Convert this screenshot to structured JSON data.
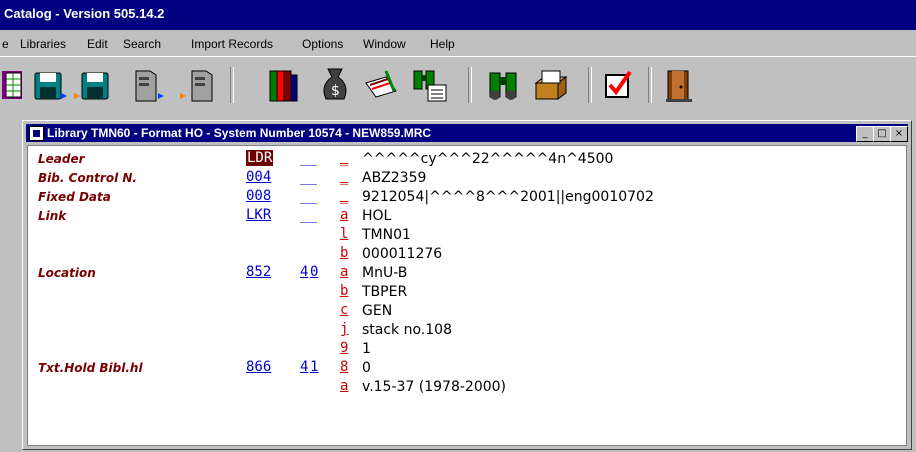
{
  "app": {
    "title": "Catalog - Version 505.14.2"
  },
  "menu": {
    "items": [
      {
        "label": "Libraries"
      },
      {
        "label": "Edit"
      },
      {
        "label": "Search"
      },
      {
        "label": "Import Records"
      },
      {
        "label": "Options"
      },
      {
        "label": "Window"
      },
      {
        "label": "Help"
      }
    ]
  },
  "toolbar": {
    "icons": [
      "grid-icon",
      "save-icon",
      "save-to-icon",
      "server-icon",
      "server-to-icon",
      "books-icon",
      "money-bag-icon",
      "edit-record-icon",
      "binoculars-list-icon",
      "binoculars-icon",
      "card-file-icon",
      "checkbox-icon",
      "exit-door-icon"
    ]
  },
  "record_window": {
    "title": "Library TMN60 - Format HO - System Number 10574 - NEW859.MRC",
    "minimize": "_",
    "maximize": "□",
    "close": "×"
  },
  "record": {
    "rows": [
      {
        "label": "Leader",
        "tag": "LDR",
        "ind1": "",
        "ind2": "",
        "sub": "",
        "value": "^^^^^cy^^^22^^^^^4n^4500"
      },
      {
        "label": "Bib. Control N.",
        "tag": "004",
        "ind1": "",
        "ind2": "",
        "sub": "",
        "value": "ABZ2359"
      },
      {
        "label": "Fixed Data",
        "tag": "008",
        "ind1": "",
        "ind2": "",
        "sub": "",
        "value": "9212054|^^^^8^^^2001||eng0010702"
      },
      {
        "label": "Link",
        "tag": "LKR",
        "ind1": "",
        "ind2": "",
        "sub": "a",
        "value": "HOL"
      },
      {
        "label": "",
        "tag": "",
        "ind1": "",
        "ind2": "",
        "sub": "l",
        "value": "TMN01"
      },
      {
        "label": "",
        "tag": "",
        "ind1": "",
        "ind2": "",
        "sub": "b",
        "value": "000011276"
      },
      {
        "label": "Location",
        "tag": "852",
        "ind1": "4",
        "ind2": "0",
        "sub": "a",
        "value": "MnU-B"
      },
      {
        "label": "",
        "tag": "",
        "ind1": "",
        "ind2": "",
        "sub": "b",
        "value": "TBPER"
      },
      {
        "label": "",
        "tag": "",
        "ind1": "",
        "ind2": "",
        "sub": "c",
        "value": "GEN"
      },
      {
        "label": "",
        "tag": "",
        "ind1": "",
        "ind2": "",
        "sub": "j",
        "value": "stack no.108"
      },
      {
        "label": "",
        "tag": "",
        "ind1": "",
        "ind2": "",
        "sub": "9",
        "value": "1"
      },
      {
        "label": "Txt.Hold Bibl.hl",
        "tag": "866",
        "ind1": "4",
        "ind2": "1",
        "sub": "8",
        "value": "0"
      },
      {
        "label": "",
        "tag": "",
        "ind1": "",
        "ind2": "",
        "sub": "a",
        "value": "v.15-37 (1978-2000)"
      }
    ]
  },
  "colors": {
    "titlebar": "#000080",
    "field_label": "#7a0000",
    "tag": "#0000cc",
    "subfield": "#cc0000",
    "leader_tag_bg": "#6a0000"
  }
}
